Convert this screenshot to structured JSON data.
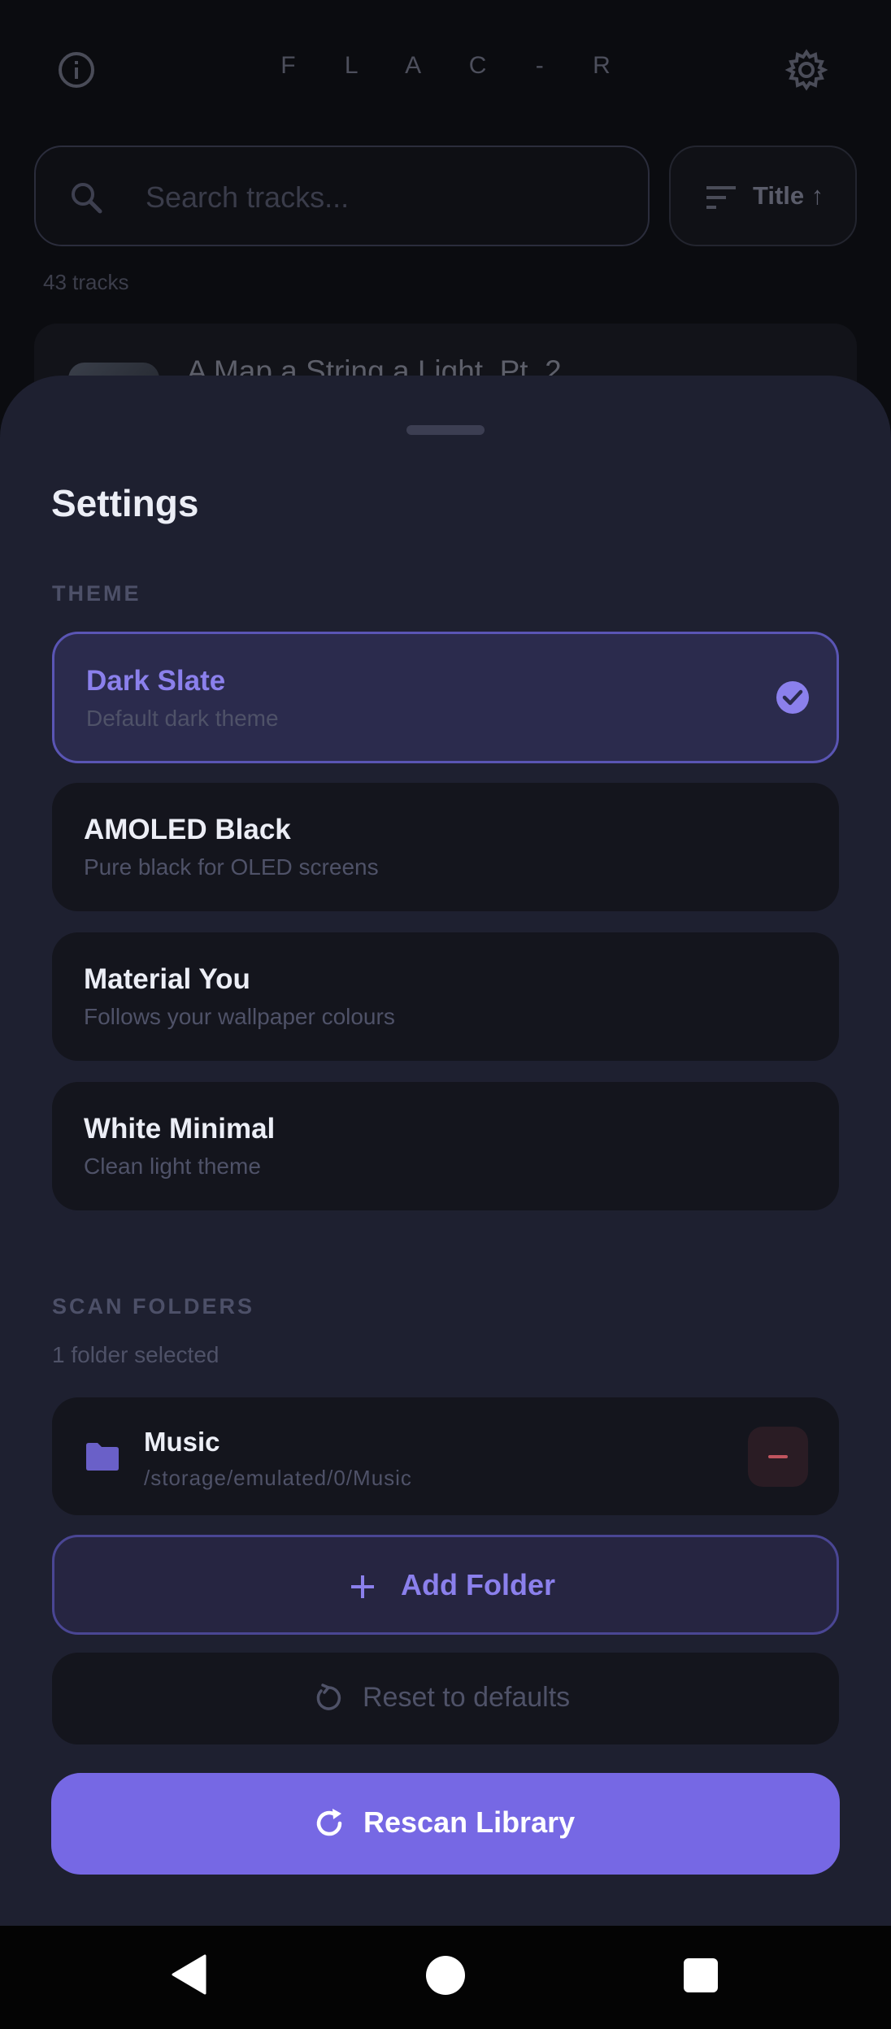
{
  "app": {
    "title": "F L A C - R"
  },
  "search": {
    "placeholder": "Search tracks..."
  },
  "sort": {
    "label": "Title ↑"
  },
  "library": {
    "track_count": "43 tracks",
    "first_track_title": "A Map a String a Light, Pt. 2"
  },
  "settings": {
    "title": "Settings",
    "theme_section_label": "THEME",
    "themes": [
      {
        "name": "Dark Slate",
        "description": "Default dark theme",
        "selected": true
      },
      {
        "name": "AMOLED Black",
        "description": "Pure black for OLED screens",
        "selected": false
      },
      {
        "name": "Material You",
        "description": "Follows your wallpaper colours",
        "selected": false
      },
      {
        "name": "White Minimal",
        "description": "Clean light theme",
        "selected": false
      }
    ],
    "scan_section_label": "SCAN FOLDERS",
    "folders_selected": "1 folder selected",
    "folders": [
      {
        "name": "Music",
        "path": "/storage/emulated/0/Music"
      }
    ],
    "add_folder_label": "Add Folder",
    "reset_label": "Reset to defaults",
    "rescan_label": "Rescan Library"
  },
  "colors": {
    "accent": "#7668e4",
    "sheet_bg": "#1e2030",
    "card_bg": "#14151d",
    "danger": "#c0545e"
  },
  "icons": {
    "info": "info-icon",
    "settings": "gear-icon",
    "search": "search-icon",
    "sort": "sort-icon",
    "check": "check-circle-icon",
    "folder": "folder-icon",
    "remove": "minus-icon",
    "add": "plus-icon",
    "reset": "reset-icon",
    "rescan": "refresh-icon"
  }
}
